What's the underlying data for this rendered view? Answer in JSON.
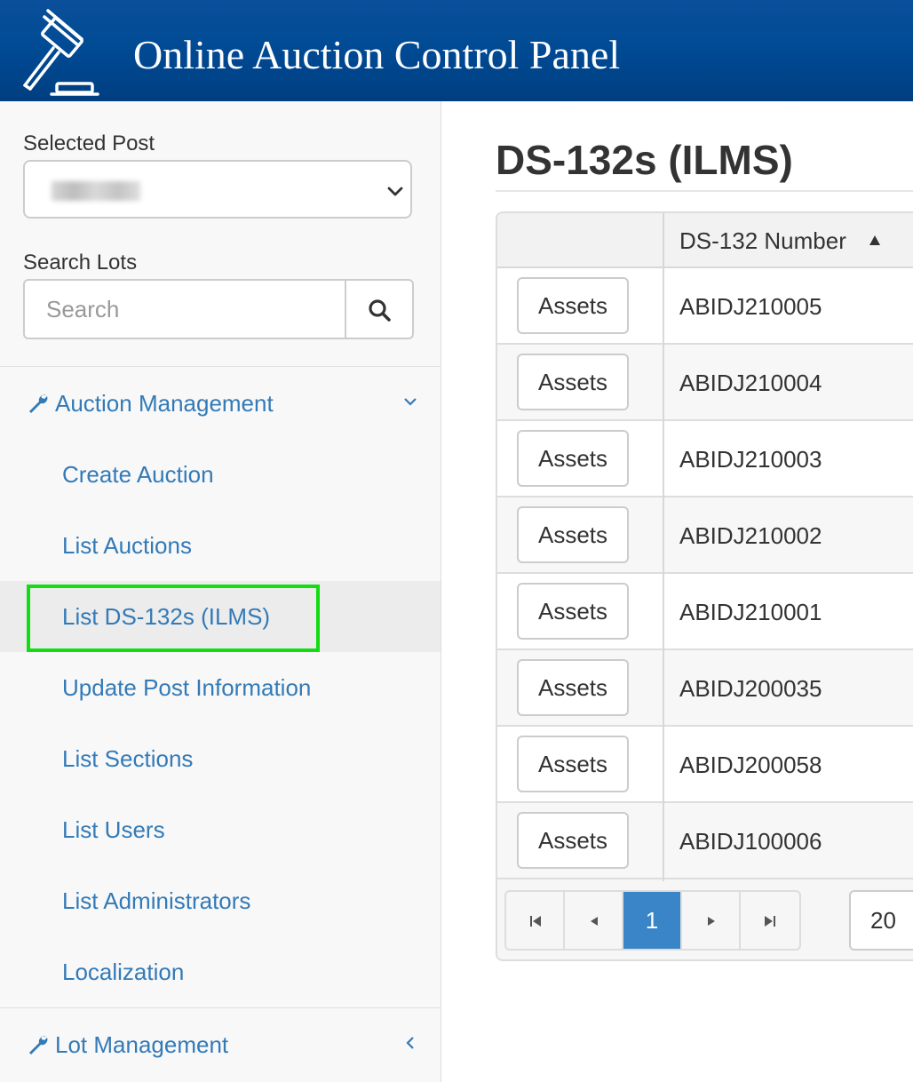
{
  "header": {
    "title": "Online Auction Control Panel"
  },
  "sidebar": {
    "selected_post_label": "Selected Post",
    "search_label": "Search Lots",
    "search_placeholder": "Search",
    "sections": [
      {
        "label": "Auction Management",
        "expanded": true,
        "items": [
          {
            "label": "Create Auction"
          },
          {
            "label": "List Auctions"
          },
          {
            "label": "List DS-132s (ILMS)",
            "active": true
          },
          {
            "label": "Update Post Information"
          },
          {
            "label": "List Sections"
          },
          {
            "label": "List Users"
          },
          {
            "label": "List Administrators"
          },
          {
            "label": "Localization"
          }
        ]
      },
      {
        "label": "Lot Management",
        "expanded": false
      }
    ]
  },
  "main": {
    "title": "DS-132s (ILMS)",
    "table": {
      "columns": [
        "",
        "DS-132 Number"
      ],
      "sort_column": "DS-132 Number",
      "sort_direction": "ascending",
      "button_label": "Assets",
      "rows": [
        "ABIDJ210005",
        "ABIDJ210004",
        "ABIDJ210003",
        "ABIDJ210002",
        "ABIDJ210001",
        "ABIDJ200035",
        "ABIDJ200058",
        "ABIDJ100006"
      ]
    },
    "pager": {
      "current_page": "1",
      "page_size": "20"
    }
  },
  "colors": {
    "header_bg": "#004a94",
    "link": "#337ab7",
    "pager_active": "#3a85c8",
    "highlight": "#11dd11",
    "active_item_bg": "#ececec"
  },
  "icons": {
    "logo": "gavel-icon",
    "search": "search-icon",
    "section": "wrench-icon",
    "expanded": "chevron-down-icon",
    "collapsed": "chevron-left-icon",
    "sort": "sort-ascending-icon"
  }
}
